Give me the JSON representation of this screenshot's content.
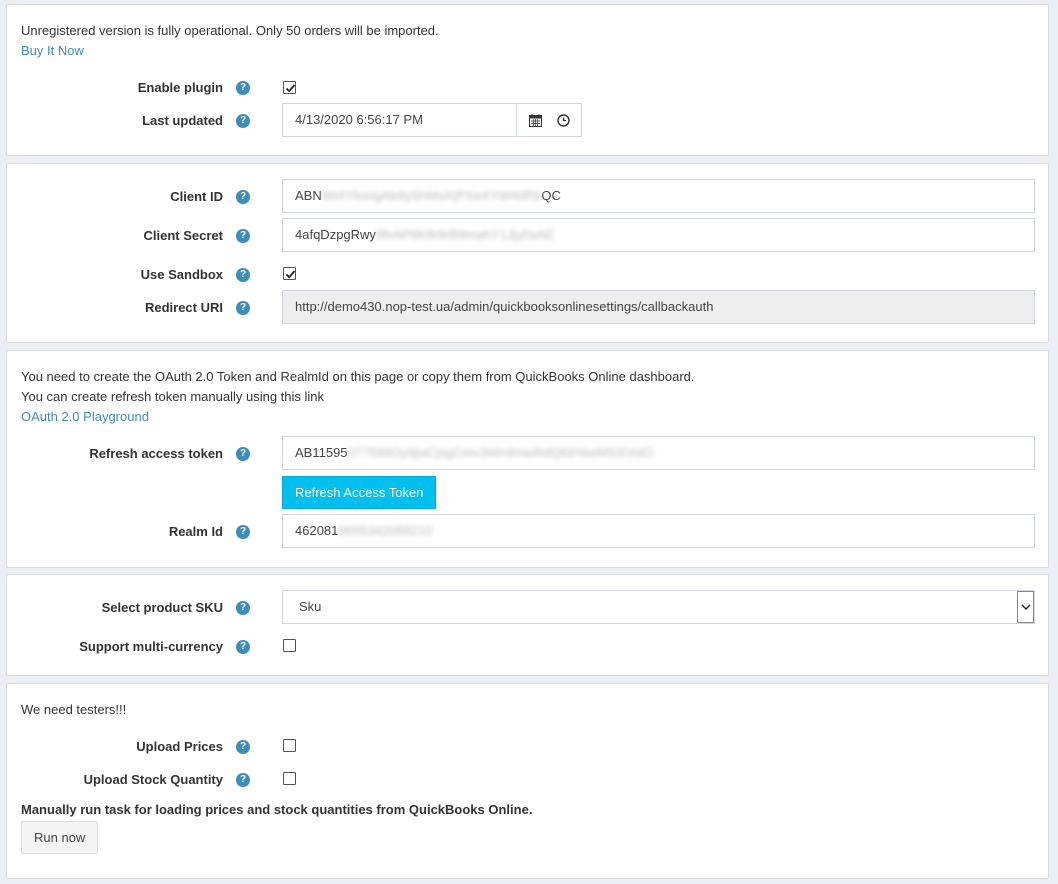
{
  "license": {
    "notice": "Unregistered version is fully operational. Only 50 orders will be imported.",
    "buy_link": "Buy It Now"
  },
  "general": {
    "enable_plugin_label": "Enable plugin",
    "enable_plugin_checked": true,
    "last_updated_label": "Last updated",
    "last_updated_value": "4/13/2020 6:56:17 PM"
  },
  "credentials": {
    "client_id_label": "Client ID",
    "client_id_visible_start": "ABN",
    "client_id_visible_end": "QC",
    "client_secret_label": "Client Secret",
    "client_secret_visible_start": "4afqDzpgRwy",
    "client_secret_visible_end": "",
    "use_sandbox_label": "Use Sandbox",
    "use_sandbox_checked": true,
    "redirect_uri_label": "Redirect URI",
    "redirect_uri_value": "http://demo430.nop-test.ua/admin/quickbooksonlinesettings/callbackauth"
  },
  "oauth": {
    "info_line1": "You need to create the OAuth 2.0 Token and RealmId on this page or copy them from QuickBooks Online dashboard.",
    "info_line2": "You can create refresh token manually using this link",
    "playground_link": "OAuth 2.0 Playground",
    "refresh_token_label": "Refresh access token",
    "refresh_token_visible_start": "AB11595",
    "refresh_button": "Refresh Access Token",
    "realm_id_label": "Realm Id",
    "realm_id_visible_start": "462081"
  },
  "product": {
    "sku_label": "Select product SKU",
    "sku_value": "Sku",
    "multi_currency_label": "Support multi-currency",
    "multi_currency_checked": false
  },
  "testers": {
    "notice": "We need testers!!!",
    "upload_prices_label": "Upload Prices",
    "upload_prices_checked": false,
    "upload_stock_label": "Upload Stock Quantity",
    "upload_stock_checked": false,
    "manual_task_text": "Manually run task for loading prices and stock quantities from QuickBooks Online.",
    "run_now_button": "Run now"
  },
  "icons": {
    "help": "question-circle-icon",
    "calendar": "calendar-icon",
    "clock": "clock-icon"
  },
  "colors": {
    "accent": "#3c8dbc",
    "primary_button": "#00c0ef"
  }
}
